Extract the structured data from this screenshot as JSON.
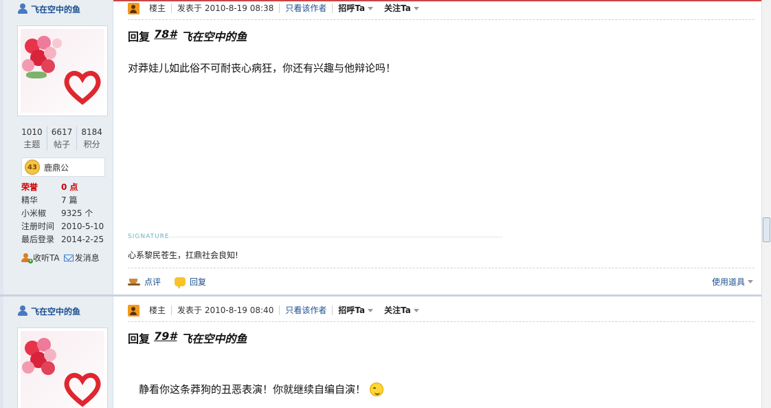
{
  "posts": [
    {
      "username": "飞在空中的鱼",
      "stats": [
        {
          "num": "1010",
          "label": "主题"
        },
        {
          "num": "6617",
          "label": "帖子"
        },
        {
          "num": "8184",
          "label": "积分"
        }
      ],
      "rank_level": "43",
      "rank_name": "鹿鼎公",
      "info": [
        {
          "key": "荣誉",
          "value": "0 点"
        },
        {
          "key": "精华",
          "value": "7 篇"
        },
        {
          "key": "小米椒",
          "value": "9325 个"
        },
        {
          "key": "注册时间",
          "value": "2010-5-10"
        },
        {
          "key": "最后登录",
          "value": "2014-2-25"
        }
      ],
      "follow_label": "收听TA",
      "message_label": "发消息",
      "owner_label": "楼主",
      "posted_at": "发表于 2010-8-19 08:38",
      "only_author": "只看该作者",
      "greet": "招呼Ta",
      "follow_ta": "关注Ta",
      "reply_prefix": "回复",
      "floor": "78#",
      "reply_to": "飞在空中的鱼",
      "body": "对莽娃儿如此俗不可耐丧心病狂，你还有兴趣与他辩论吗！",
      "signature_label": "SIGNATURE",
      "signature": "心系黎民苍生，扛鼎社会良知!",
      "comment_label": "点评",
      "reply_label": "回复",
      "tools_label": "使用道具"
    },
    {
      "username": "飞在空中的鱼",
      "owner_label": "楼主",
      "posted_at": "发表于 2010-8-19 08:40",
      "only_author": "只看该作者",
      "greet": "招呼Ta",
      "follow_ta": "关注Ta",
      "reply_prefix": "回复",
      "floor": "79#",
      "reply_to": "飞在空中的鱼",
      "body": "静看你这条莽狗的丑恶表演！你就继续自编自演！"
    }
  ],
  "icons": {
    "user": "user-icon",
    "owner": "owner-icon",
    "rank": "rank-badge-icon",
    "follow": "follow-user-icon",
    "message": "mail-icon",
    "comment": "coffee-cup-icon",
    "reply": "speech-bubble-icon",
    "emoji": "smiley-icon"
  },
  "colors": {
    "link": "#1a4f8f",
    "honor": "#cc0000",
    "sidebar_bg": "#e9eef3",
    "top_line": "#cc4444"
  }
}
